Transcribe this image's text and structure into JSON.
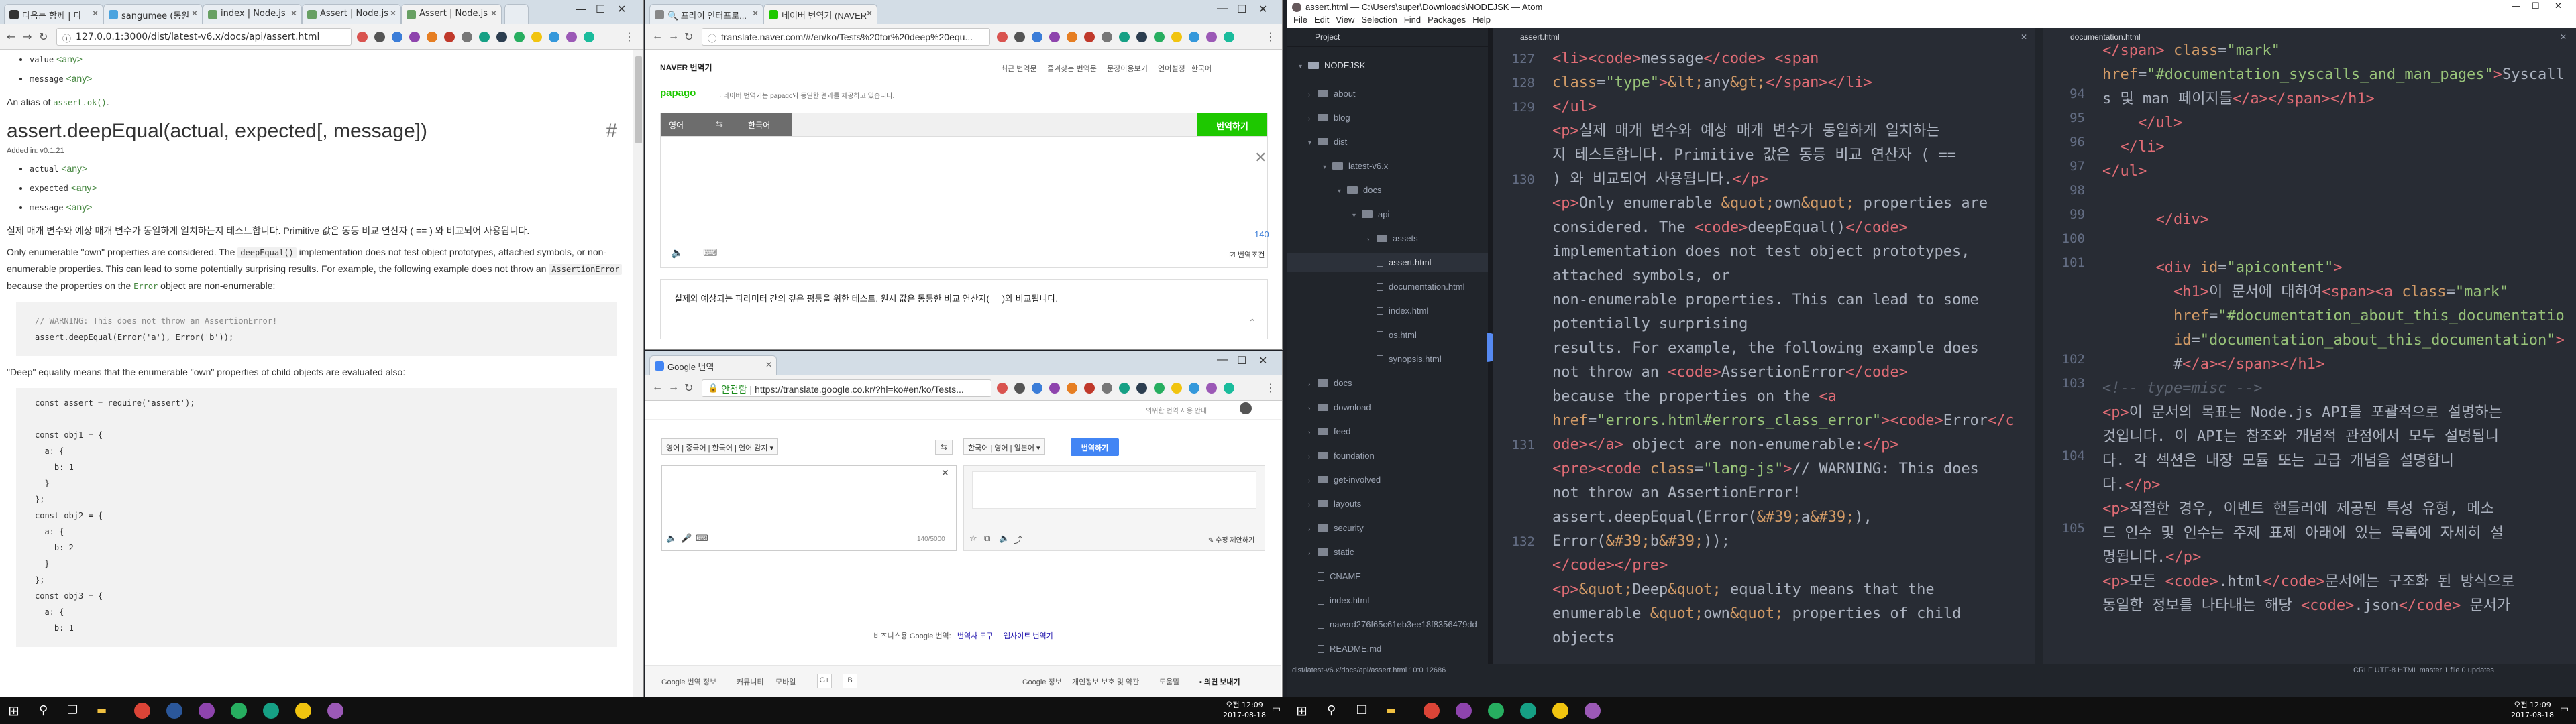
{
  "win1": {
    "tabs": [
      {
        "label": "다음는 함께 | 다"
      },
      {
        "label": "sangumee (동원"
      },
      {
        "label": "index | Node.js"
      },
      {
        "label": "Assert | Node.js"
      },
      {
        "label": "Assert | Node.js"
      }
    ],
    "url": "127.0.0.1:3000/dist/latest-v6.x/docs/api/assert.html",
    "doc": {
      "top_items": [
        {
          "name": "value",
          "type": "<any>"
        },
        {
          "name": "message",
          "type": "<any>"
        }
      ],
      "alias_prefix": "An alias of ",
      "alias_link": "assert.ok()",
      "alias_suffix": ".",
      "heading": "assert.deepEqual(actual, expected[, message])",
      "hash": "#",
      "added": "Added in: v0.1.21",
      "params": [
        {
          "name": "actual",
          "type": "<any>"
        },
        {
          "name": "expected",
          "type": "<any>"
        },
        {
          "name": "message",
          "type": "<any>"
        }
      ],
      "korean_para": "실제 매개 변수와 예상 매개 변수가 동일하게 일치하는지 테스트합니다. Primitive 값은 동등 비교 연산자 ( == ) 와 비교되어 사용됩니다.",
      "p2_a": "Only enumerable \"own\" properties are considered. The ",
      "p2_code": "deepEqual()",
      "p2_b": " implementation does not test object prototypes, attached symbols, or non-enumerable properties. This can lead to some potentially surprising results. For example, the following example does not throw an ",
      "p2_code2": "AssertionError",
      "p2_c": " because the properties on the ",
      "p2_link": "Error",
      "p2_d": " object are non-enumerable:",
      "code1_l1": "// WARNING: This does not throw an AssertionError!",
      "code1_l2": "assert.deepEqual(Error('a'), Error('b'));",
      "p3": "\"Deep\" equality means that the enumerable \"own\" properties of child objects are evaluated also:",
      "code2": [
        "const assert = require('assert');",
        "",
        "const obj1 = {",
        "  a: {",
        "    b: 1",
        "  }",
        "};",
        "const obj2 = {",
        "  a: {",
        "    b: 2",
        "  }",
        "};",
        "const obj3 = {",
        "  a: {",
        "    b: 1"
      ]
    }
  },
  "win2": {
    "tabs": [
      {
        "label": "🔍 프라이 인터프로..."
      },
      {
        "label": "네이버 번역기 (NAVER"
      }
    ],
    "url": "translate.naver.com/#/en/ko/Tests%20for%20deep%20equ...",
    "brand": "NAVER 번역기",
    "nav": [
      "최근 번역문",
      "즐겨찾는 번역문",
      "문장이용보기",
      "언어설정",
      "한국어"
    ],
    "papago": "papago",
    "papago_note": "· 네이버 번역기는 papago와 동일한 결과를 제공하고 있습니다.",
    "src_lang": "영어",
    "swap": "⇆",
    "tgt_lang": "한국어",
    "translate_btn": "번역하기",
    "char_count": "140",
    "auto": "번역조건",
    "result": "실제와 예상되는 파라미터 간의 깊은 평등을 위한 테스트. 원시 값은 동등한 비교 연산자(= =)와 비교됩니다."
  },
  "win3": {
    "tab": "Google 번역",
    "secure": "안전함",
    "url": "https://translate.google.co.kr/?hl=ko#en/ko/Tests...",
    "hint": "의위한 번역 사용 안내",
    "src_langs": [
      "영어",
      "중국어",
      "한국어",
      "언어 감지"
    ],
    "tgt_langs": [
      "한국어",
      "영어",
      "일본어"
    ],
    "translate_btn": "번역하기",
    "count": "140/5000",
    "edit": "수정 제안하기",
    "footer1": "비즈니스용 Google 번역:",
    "footer_link1": "번역사 도구",
    "footer_link2": "웹사이트 번역기",
    "bottom": [
      "Google 번역 정보",
      "커뮤니티",
      "모바일"
    ],
    "bottom_right": [
      "Google 정보",
      "개인정보 보호 및 약관",
      "도움말",
      "의견 보내기"
    ]
  },
  "atom": {
    "title": "assert.html — C:\\Users\\super\\Downloads\\NODEJSK — Atom",
    "menu": [
      "File",
      "Edit",
      "View",
      "Selection",
      "Find",
      "Packages",
      "Help"
    ],
    "project_label": "Project",
    "tree_root": "NODEJSK",
    "tree": [
      {
        "label": "about",
        "kind": "folder",
        "depth": 0
      },
      {
        "label": "blog",
        "kind": "folder",
        "depth": 0
      },
      {
        "label": "dist",
        "kind": "folder",
        "depth": 0,
        "open": true
      },
      {
        "label": "latest-v6.x",
        "kind": "folder",
        "depth": 1,
        "open": true
      },
      {
        "label": "docs",
        "kind": "folder",
        "depth": 2,
        "open": true
      },
      {
        "label": "api",
        "kind": "folder",
        "depth": 3,
        "open": true
      },
      {
        "label": "assets",
        "kind": "folder",
        "depth": 4
      },
      {
        "label": "assert.html",
        "kind": "file",
        "depth": 4,
        "selected": true
      },
      {
        "label": "documentation.html",
        "kind": "file",
        "depth": 4
      },
      {
        "label": "index.html",
        "kind": "file",
        "depth": 4
      },
      {
        "label": "os.html",
        "kind": "file",
        "depth": 4
      },
      {
        "label": "synopsis.html",
        "kind": "file",
        "depth": 4
      },
      {
        "label": "docs",
        "kind": "folder",
        "depth": 0
      },
      {
        "label": "download",
        "kind": "folder",
        "depth": 0
      },
      {
        "label": "feed",
        "kind": "folder",
        "depth": 0
      },
      {
        "label": "foundation",
        "kind": "folder",
        "depth": 0
      },
      {
        "label": "get-involved",
        "kind": "folder",
        "depth": 0
      },
      {
        "label": "layouts",
        "kind": "folder",
        "depth": 0
      },
      {
        "label": "security",
        "kind": "folder",
        "depth": 0
      },
      {
        "label": "static",
        "kind": "folder",
        "depth": 0
      },
      {
        "label": "CNAME",
        "kind": "file",
        "depth": 0
      },
      {
        "label": "index.html",
        "kind": "file",
        "depth": 0
      },
      {
        "label": "naverd276f65c61eb3ee18f8356479dd",
        "kind": "file",
        "depth": 0
      },
      {
        "label": "README.md",
        "kind": "file",
        "depth": 0
      }
    ],
    "left_tab": "assert.html",
    "right_tab": "documentation.html",
    "left_lines": [
      "127",
      "128",
      "129",
      "",
      "",
      "130",
      "",
      "",
      "",
      "",
      "",
      "",
      "",
      "",
      "",
      "",
      "131",
      "",
      "",
      "",
      "132",
      "",
      ""
    ],
    "right_lines": [
      "",
      "94",
      "95",
      "96",
      "97",
      "98",
      "99",
      "100",
      "101",
      "",
      "",
      "",
      "102",
      "103",
      "",
      "",
      "104",
      "",
      "",
      "105",
      ""
    ],
    "status_left": "dist/latest-v6.x/docs/api/assert.html  10:0  12686",
    "status_right": "CRLF  UTF-8  HTML  master  1 file  0 updates"
  },
  "taskbar": {
    "left_clock_time": "오전 12:09",
    "left_clock_date": "2017-08-18",
    "right_clock_time": "오전 12:09",
    "right_clock_date": "2017-08-18"
  }
}
